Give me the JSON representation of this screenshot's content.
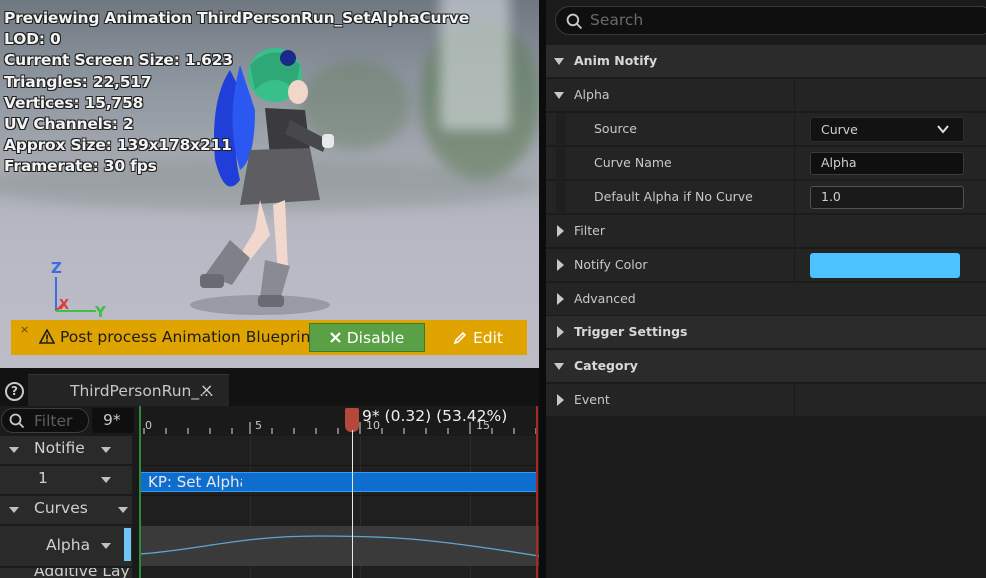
{
  "viewport": {
    "stats": [
      "Previewing Animation ThirdPersonRun_SetAlphaCurve",
      "LOD: 0",
      "Current Screen Size: 1.623",
      "Triangles: 22,517",
      "Vertices: 15,758",
      "UV Channels: 2",
      "Approx Size: 139x178x211",
      "Framerate: 30 fps"
    ],
    "axes": {
      "z": "Z",
      "x": "X",
      "y": "Y"
    },
    "warning": {
      "close": "×",
      "text": "Post process Animation Blueprint",
      "disable_label": "Disable",
      "edit_label": "Edit"
    }
  },
  "timeline": {
    "help": "?",
    "tab_label": "ThirdPersonRun_...",
    "tab_close": "×",
    "filter_placeholder": "Filter",
    "frame_value": "9*",
    "tracks": {
      "notifies": "Notifie",
      "notify_track": "1",
      "curves": "Curves",
      "alpha": "Alpha",
      "additive": "Additive Lay"
    },
    "ruler_labels": [
      "0",
      "5",
      "10",
      "15"
    ],
    "scrub_label": "9* (0.32) (53.42%)",
    "notify_label": "KP: Set Alpha"
  },
  "details": {
    "search_placeholder": "Search",
    "rows": {
      "anim_notify": "Anim Notify",
      "alpha": "Alpha",
      "source": "Source",
      "source_value": "Curve",
      "curve_name": "Curve Name",
      "curve_name_value": "Alpha",
      "default_alpha": "Default Alpha if No Curve",
      "default_alpha_value": "1.0",
      "filter": "Filter",
      "notify_color": "Notify Color",
      "advanced": "Advanced",
      "trigger_settings": "Trigger Settings",
      "category": "Category",
      "event": "Event"
    },
    "notify_color_hex": "#4cc3ff"
  }
}
